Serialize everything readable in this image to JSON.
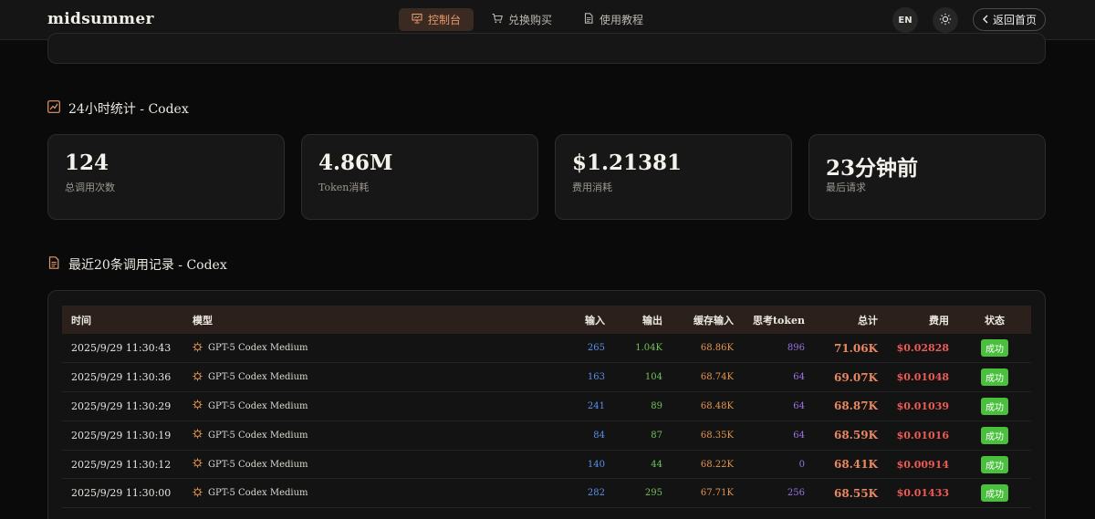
{
  "header": {
    "logo": "midsummer",
    "nav": [
      {
        "label": "控制台",
        "icon": "presentation-icon",
        "active": true
      },
      {
        "label": "兑换购买",
        "icon": "cart-icon",
        "active": false
      },
      {
        "label": "使用教程",
        "icon": "document-icon",
        "active": false
      }
    ],
    "lang_label": "EN",
    "theme_icon": "sun-icon",
    "back_label": "返回首页"
  },
  "stats_section": {
    "title": "24小时统计 - Codex",
    "cards": [
      {
        "value": "124",
        "label": "总调用次数"
      },
      {
        "value": "4.86M",
        "label": "Token消耗"
      },
      {
        "value": "$1.21381",
        "label": "费用消耗"
      },
      {
        "value": "23分钟前",
        "label": "最后请求"
      }
    ]
  },
  "records_section": {
    "title": "最近20条调用记录 - Codex",
    "columns": [
      "时间",
      "模型",
      "输入",
      "输出",
      "缓存输入",
      "思考token",
      "总计",
      "费用",
      "状态"
    ],
    "rows": [
      {
        "time": "2025/9/29 11:30:43",
        "model": "GPT-5 Codex Medium",
        "input": "265",
        "output": "1.04K",
        "cache": "68.86K",
        "think": "896",
        "total": "71.06K",
        "cost": "$0.02828",
        "status": "成功"
      },
      {
        "time": "2025/9/29 11:30:36",
        "model": "GPT-5 Codex Medium",
        "input": "163",
        "output": "104",
        "cache": "68.74K",
        "think": "64",
        "total": "69.07K",
        "cost": "$0.01048",
        "status": "成功"
      },
      {
        "time": "2025/9/29 11:30:29",
        "model": "GPT-5 Codex Medium",
        "input": "241",
        "output": "89",
        "cache": "68.48K",
        "think": "64",
        "total": "68.87K",
        "cost": "$0.01039",
        "status": "成功"
      },
      {
        "time": "2025/9/29 11:30:19",
        "model": "GPT-5 Codex Medium",
        "input": "84",
        "output": "87",
        "cache": "68.35K",
        "think": "64",
        "total": "68.59K",
        "cost": "$0.01016",
        "status": "成功"
      },
      {
        "time": "2025/9/29 11:30:12",
        "model": "GPT-5 Codex Medium",
        "input": "140",
        "output": "44",
        "cache": "68.22K",
        "think": "0",
        "total": "68.41K",
        "cost": "$0.00914",
        "status": "成功"
      },
      {
        "time": "2025/9/29 11:30:00",
        "model": "GPT-5 Codex Medium",
        "input": "282",
        "output": "295",
        "cache": "67.71K",
        "think": "256",
        "total": "68.55K",
        "cost": "$0.01433",
        "status": "成功"
      }
    ]
  },
  "colors": {
    "accent": "#e69a6c",
    "input": "#5b8fe6",
    "output": "#74c05a",
    "cache": "#e3954f",
    "think": "#9a72e2",
    "total": "#e98760",
    "cost": "#ee5a54",
    "success": "#4bbf3e"
  }
}
